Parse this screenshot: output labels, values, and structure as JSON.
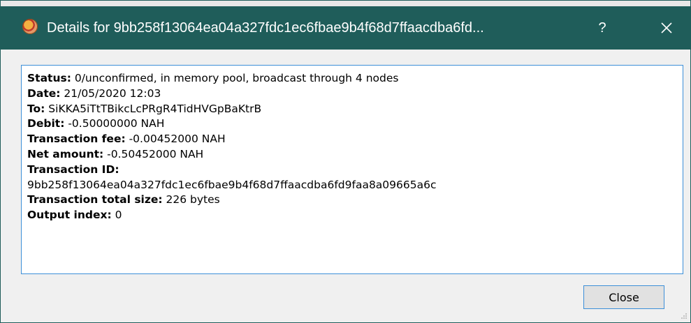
{
  "window": {
    "title": "Details for 9bb258f13064ea04a327fdc1ec6fbae9b4f68d7ffaacdba6fd...",
    "help_label": "?",
    "close_glyph": "✕",
    "app_icon": "coin-logo-icon"
  },
  "colors": {
    "titlebar": "#1f5d5a",
    "accent_border": "#3c8fd8",
    "dialog_bg": "#f0f0f0"
  },
  "details": {
    "status_label": "Status:",
    "status_value": " 0/unconfirmed, in memory pool, broadcast through 4 nodes",
    "date_label": "Date:",
    "date_value": " 21/05/2020 12:03",
    "to_label": "To:",
    "to_value": " SiKKA5iTtTBikcLcPRgR4TidHVGpBaKtrB",
    "debit_label": "Debit:",
    "debit_value": " -0.50000000 NAH",
    "fee_label": "Transaction fee:",
    "fee_value": " -0.00452000 NAH",
    "net_label": "Net amount:",
    "net_value": " -0.50452000 NAH",
    "txid_label": "Transaction ID:",
    "txid_value": "9bb258f13064ea04a327fdc1ec6fbae9b4f68d7ffaacdba6fd9faa8a09665a6c",
    "size_label": "Transaction total size:",
    "size_value": " 226 bytes",
    "output_label": "Output index:",
    "output_value": " 0"
  },
  "buttons": {
    "close_label": "Close"
  }
}
